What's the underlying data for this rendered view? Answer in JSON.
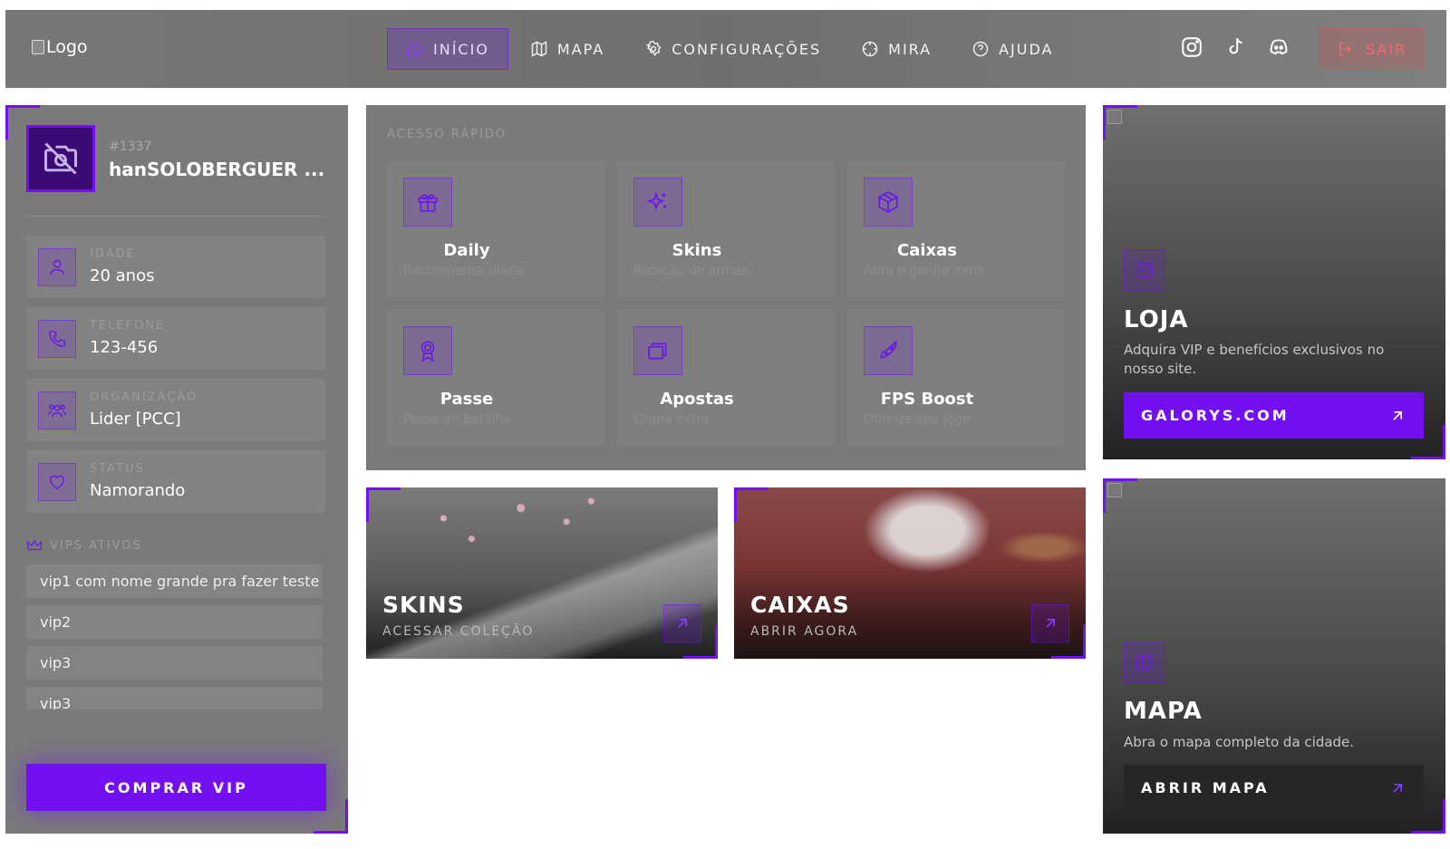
{
  "header": {
    "logo_alt": "Logo",
    "nav": [
      {
        "label": "INÍCIO",
        "icon": "home-icon",
        "active": true
      },
      {
        "label": "MAPA",
        "icon": "map-icon",
        "active": false
      },
      {
        "label": "CONFIGURAÇÕES",
        "icon": "gear-icon",
        "active": false
      },
      {
        "label": "MIRA",
        "icon": "crosshair-icon",
        "active": false
      },
      {
        "label": "AJUDA",
        "icon": "help-icon",
        "active": false
      }
    ],
    "socials": [
      "instagram-icon",
      "tiktok-icon",
      "discord-icon"
    ],
    "logout_label": "SAIR"
  },
  "profile": {
    "id": "#1337",
    "name": "hanSOLOBERGUER ...",
    "fields": [
      {
        "label": "IDADE",
        "value": "20 anos",
        "icon": "user-icon"
      },
      {
        "label": "TELEFONE",
        "value": "123-456",
        "icon": "phone-icon"
      },
      {
        "label": "ORGANIZAÇÃO",
        "value": "Lider [PCC]",
        "icon": "group-icon"
      },
      {
        "label": "STATUS",
        "value": "Namorando",
        "icon": "heart-icon"
      }
    ],
    "vips_title": "VIPS ATIVOS",
    "vips": [
      "vip1 com nome grande pra fazer teste",
      "vip2",
      "vip3",
      "vip3"
    ],
    "buy_label": "COMPRAR VIP"
  },
  "quick_access": {
    "title": "ACESSO RÁPIDO",
    "items": [
      {
        "title": "Daily",
        "subtitle": "Recompensa diária",
        "icon": "gift-icon"
      },
      {
        "title": "Skins",
        "subtitle": "Rotação de armas",
        "icon": "sparkles-icon"
      },
      {
        "title": "Caixas",
        "subtitle": "Abra e ganhe itens",
        "icon": "box-icon"
      },
      {
        "title": "Passe",
        "subtitle": "Passe de batalha",
        "icon": "award-icon"
      },
      {
        "title": "Apostas",
        "subtitle": "Grana extra",
        "icon": "cards-icon"
      },
      {
        "title": "FPS Boost",
        "subtitle": "Otimize seu jogo",
        "icon": "rocket-icon"
      }
    ]
  },
  "banners": [
    {
      "title": "SKINS",
      "subtitle": "ACESSAR COLEÇÃO"
    },
    {
      "title": "CAIXAS",
      "subtitle": "ABRIR AGORA"
    }
  ],
  "store": {
    "title": "LOJA",
    "description": "Adquira VIP e benefícios exclusivos no nosso site.",
    "cta": "GALORYS.COM"
  },
  "map_card": {
    "title": "MAPA",
    "description": "Abra o mapa completo da cidade.",
    "cta": "ABRIR MAPA"
  },
  "colors": {
    "accent": "#7210f2",
    "logout": "#f06b6b"
  }
}
